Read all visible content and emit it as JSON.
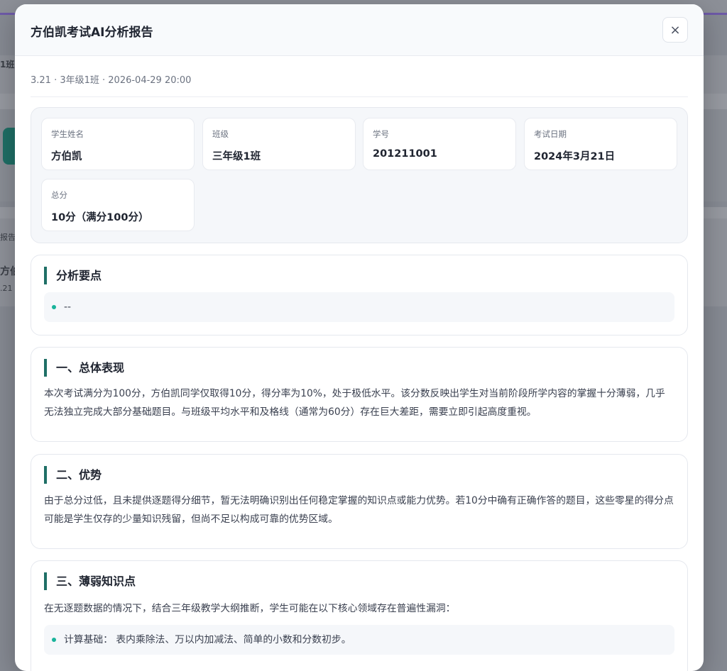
{
  "background": {
    "left_text_1": "1班",
    "left_text_2": "报告",
    "left_text_3": "方伯",
    "left_text_4": ".21"
  },
  "modal": {
    "title": "方伯凯考试AI分析报告",
    "close_icon": "×",
    "meta": "3.21 · 3年级1班 · 2026-04-29 20:00"
  },
  "info": {
    "cards": [
      {
        "label": "学生姓名",
        "value": "方伯凯"
      },
      {
        "label": "班级",
        "value": "三年级1班"
      },
      {
        "label": "学号",
        "value": "201211001"
      },
      {
        "label": "考试日期",
        "value": "2024年3月21日"
      },
      {
        "label": "总分",
        "value": "10分（满分100分）"
      }
    ]
  },
  "sections": {
    "key_points": {
      "title": "分析要点",
      "items": [
        "--"
      ]
    },
    "overall": {
      "title": "一、总体表现",
      "text": "本次考试满分为100分，方伯凯同学仅取得10分，得分率为10%，处于极低水平。该分数反映出学生对当前阶段所学内容的掌握十分薄弱，几乎无法独立完成大部分基础题目。与班级平均水平和及格线（通常为60分）存在巨大差距，需要立即引起高度重视。"
    },
    "strengths": {
      "title": "二、优势",
      "text": "由于总分过低，且未提供逐题得分细节，暂无法明确识别出任何稳定掌握的知识点或能力优势。若10分中确有正确作答的题目，这些零星的得分点可能是学生仅存的少量知识残留，但尚不足以构成可靠的优势区域。"
    },
    "weak": {
      "title": "三、薄弱知识点",
      "text": "在无逐题数据的情况下，结合三年级教学大纲推断，学生可能在以下核心领域存在普遍性漏洞：",
      "items": [
        "计算基础： 表内乘除法、万以内加减法、简单的小数和分数初步。"
      ]
    }
  },
  "colors": {
    "accent": "#1f6f66",
    "bullet": "#19b39a"
  }
}
